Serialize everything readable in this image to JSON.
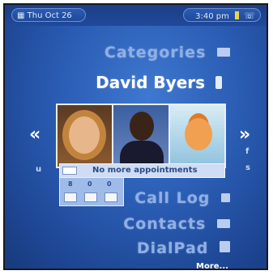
{
  "status": {
    "date": "Thu Oct 26",
    "time": "3:40 pm"
  },
  "menu": {
    "categories": "Categories",
    "contact_name": "David Byers",
    "call_log": "Call Log",
    "contacts": "Contacts",
    "dialpad": "DialPad",
    "more": "More..."
  },
  "appointments": {
    "text": "No more appointments",
    "digits": [
      "8",
      "0",
      "0"
    ]
  },
  "nav": {
    "prev": "«",
    "next": "»",
    "left_letter": "u",
    "right_letters": [
      "f",
      "s"
    ]
  },
  "colors": {
    "background": "#2a5cb3",
    "highlight": "#ffffff",
    "dim_text": "#8fb0e6"
  }
}
